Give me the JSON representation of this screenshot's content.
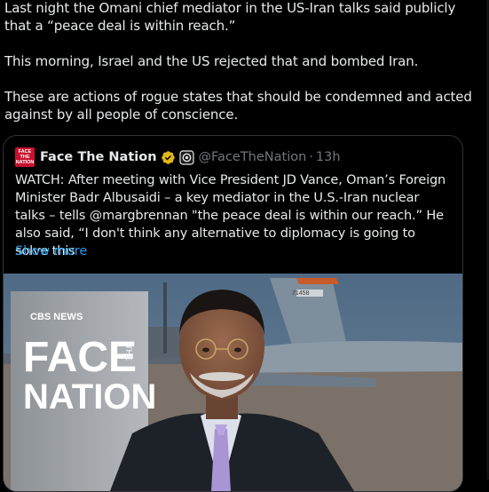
{
  "post": {
    "paragraphs": [
      "Last night the Omani chief mediator in the US-Iran talks said publicly that a “peace deal is within reach.”",
      "This morning, Israel and the US rejected that and bombed Iran.",
      "These are actions of rogue states that should be condemned and acted against by all people of conscience."
    ]
  },
  "quote": {
    "avatar_lines": [
      "FACE",
      "THE",
      "NATION"
    ],
    "name": "Face The Nation",
    "handle": "@FaceTheNation",
    "separator": "·",
    "time": "13h",
    "text": "WATCH: After meeting with Vice President JD Vance, Oman’s Foreign Minister Badr Albusaidi – a key mediator in the U.S.-Iran nuclear talks – tells @margbrennan \"the peace deal is within our reach.” He also said, “I don't think any alternative to diplomacy is going to solve this",
    "show_more": "Show more",
    "verified_icon": "gold-check-icon",
    "affiliation_icon": "affiliate-badge-icon"
  },
  "media": {
    "screen_brand": "CBS NEWS",
    "screen_title_1": "FACE",
    "screen_title_2": "NATION",
    "screen_side": "THE",
    "plane_number": "71458"
  }
}
